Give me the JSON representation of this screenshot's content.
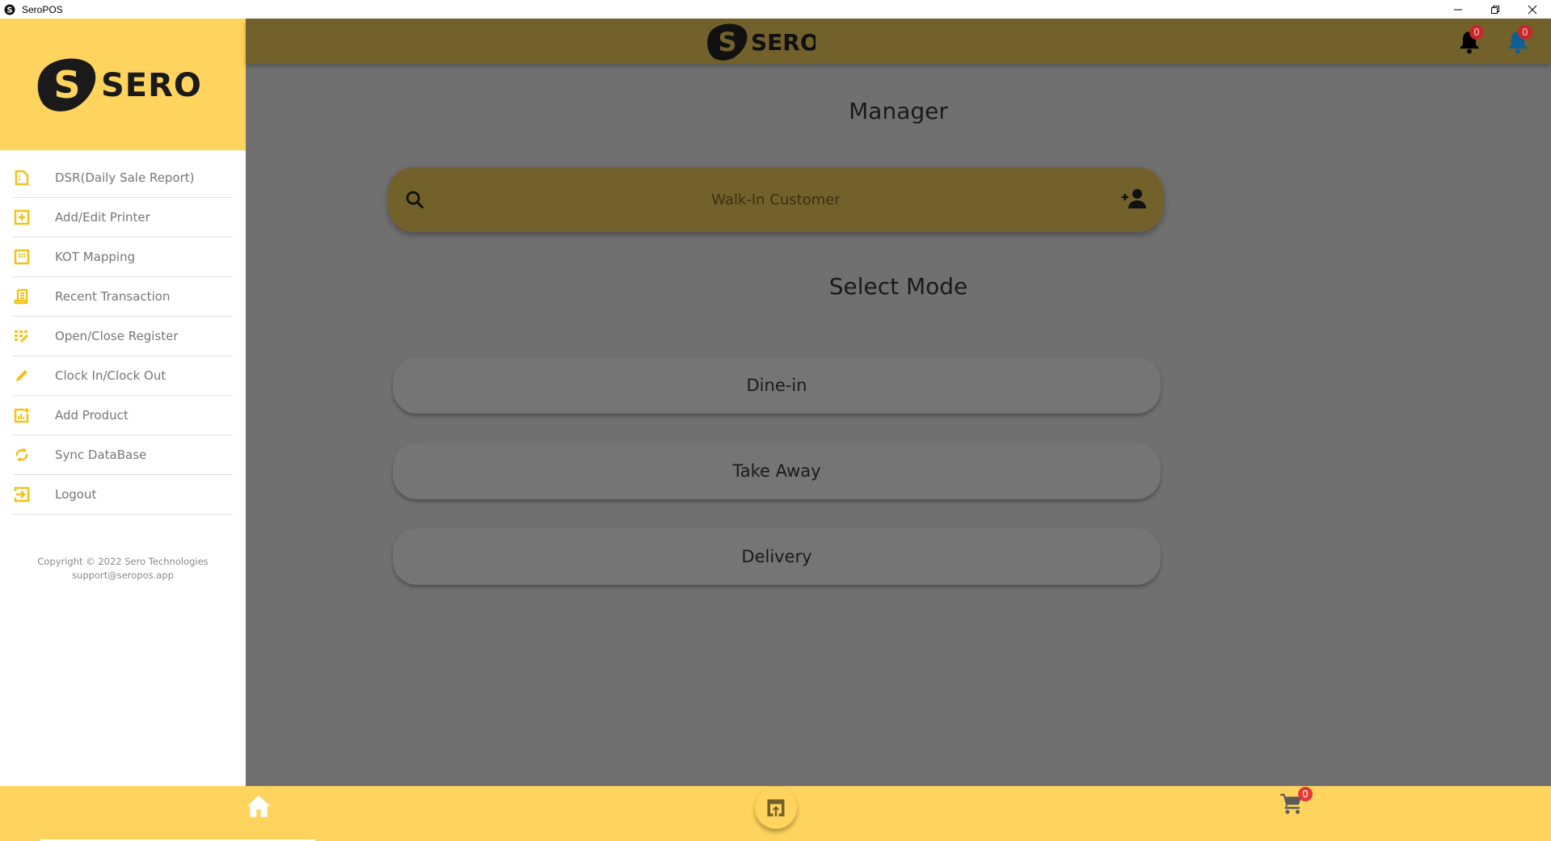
{
  "window": {
    "title": "SeroPOS",
    "controls": [
      "minimize",
      "restore",
      "close"
    ]
  },
  "brand": {
    "name": "SERO",
    "colors": {
      "primary": "#FFD45E",
      "overlay": "#707070",
      "header_dimmed": "#73612B",
      "badge": "#C62828"
    }
  },
  "sidebar": {
    "items": [
      {
        "label": "DSR(Daily Sale Report)",
        "icon": "report-icon"
      },
      {
        "label": "Add/Edit Printer",
        "icon": "add-box-icon"
      },
      {
        "label": "KOT Mapping",
        "icon": "grid-icon"
      },
      {
        "label": "Recent Transaction",
        "icon": "receipt-icon"
      },
      {
        "label": "Open/Close Register",
        "icon": "register-icon"
      },
      {
        "label": "Clock In/Clock Out",
        "icon": "pencil-icon"
      },
      {
        "label": "Add Product",
        "icon": "add-chart-icon"
      },
      {
        "label": "Sync DataBase",
        "icon": "sync-icon"
      },
      {
        "label": "Logout",
        "icon": "logout-icon"
      }
    ],
    "copyright": "Copyright © 2022 Sero Technologies",
    "support_email": "support@seropos.app"
  },
  "header": {
    "notifications": {
      "count": "0"
    },
    "alerts": {
      "count": "0"
    }
  },
  "main": {
    "role_title": "Manager",
    "customer_search": {
      "placeholder": "Walk-In Customer",
      "value": ""
    },
    "mode_title": "Select Mode",
    "modes": [
      "Dine-in",
      "Take Away",
      "Delivery"
    ]
  },
  "bottom_nav": {
    "cart_count": "0"
  }
}
